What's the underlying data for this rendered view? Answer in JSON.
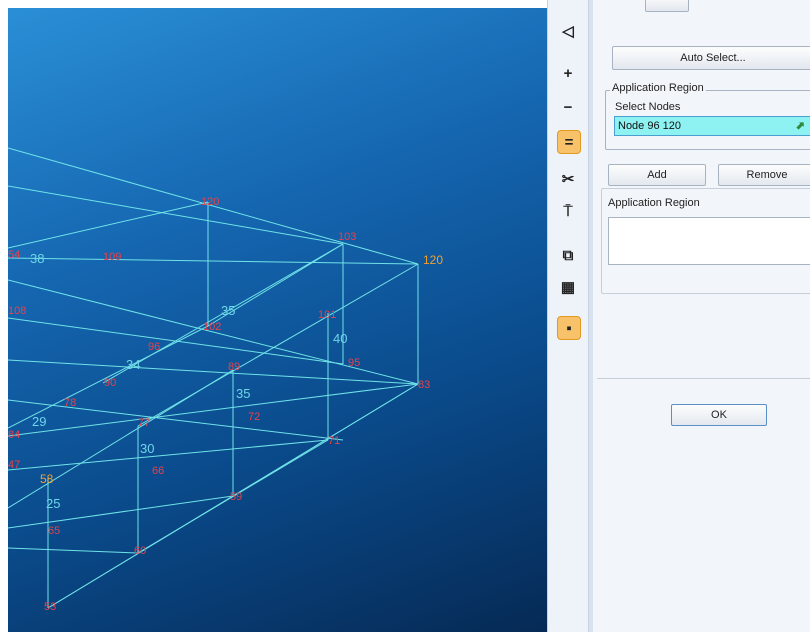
{
  "viewport": {
    "red_labels": [
      "120",
      "103",
      "109",
      "108",
      "102",
      "101",
      "95",
      "96",
      "90",
      "89",
      "83",
      "84",
      "78",
      "72",
      "77",
      "71",
      "66",
      "65",
      "59",
      "60",
      "53",
      "47",
      "54"
    ],
    "cyan_labels": [
      "38",
      "35",
      "40",
      "34",
      "35",
      "29",
      "30",
      "25"
    ],
    "highlight_labels": [
      "120",
      "58"
    ]
  },
  "toolbar": {
    "tools": [
      {
        "name": "select-tool-icon",
        "glyph": "◁",
        "active": false
      },
      {
        "name": "zoom-in-icon",
        "glyph": "+",
        "active": false
      },
      {
        "name": "zoom-out-icon",
        "glyph": "−",
        "active": false
      },
      {
        "name": "equal-icon",
        "glyph": "=",
        "active": true
      },
      {
        "name": "scissors-icon",
        "glyph": "✂",
        "active": false
      },
      {
        "name": "filter-icon",
        "glyph": "⍑",
        "active": false
      },
      {
        "name": "copy-icon",
        "glyph": "⧉",
        "active": false
      },
      {
        "name": "grid-icon",
        "glyph": "▦",
        "active": false
      },
      {
        "name": "node-icon",
        "glyph": "▪",
        "active": true
      }
    ]
  },
  "panel": {
    "auto_select_label": "Auto Select...",
    "group_title": "Application Region",
    "select_nodes_label": "Select Nodes",
    "node_value": "Node 96 120",
    "add_label": "Add",
    "remove_label": "Remove",
    "region_label": "Application Region",
    "ok_label": "OK"
  }
}
